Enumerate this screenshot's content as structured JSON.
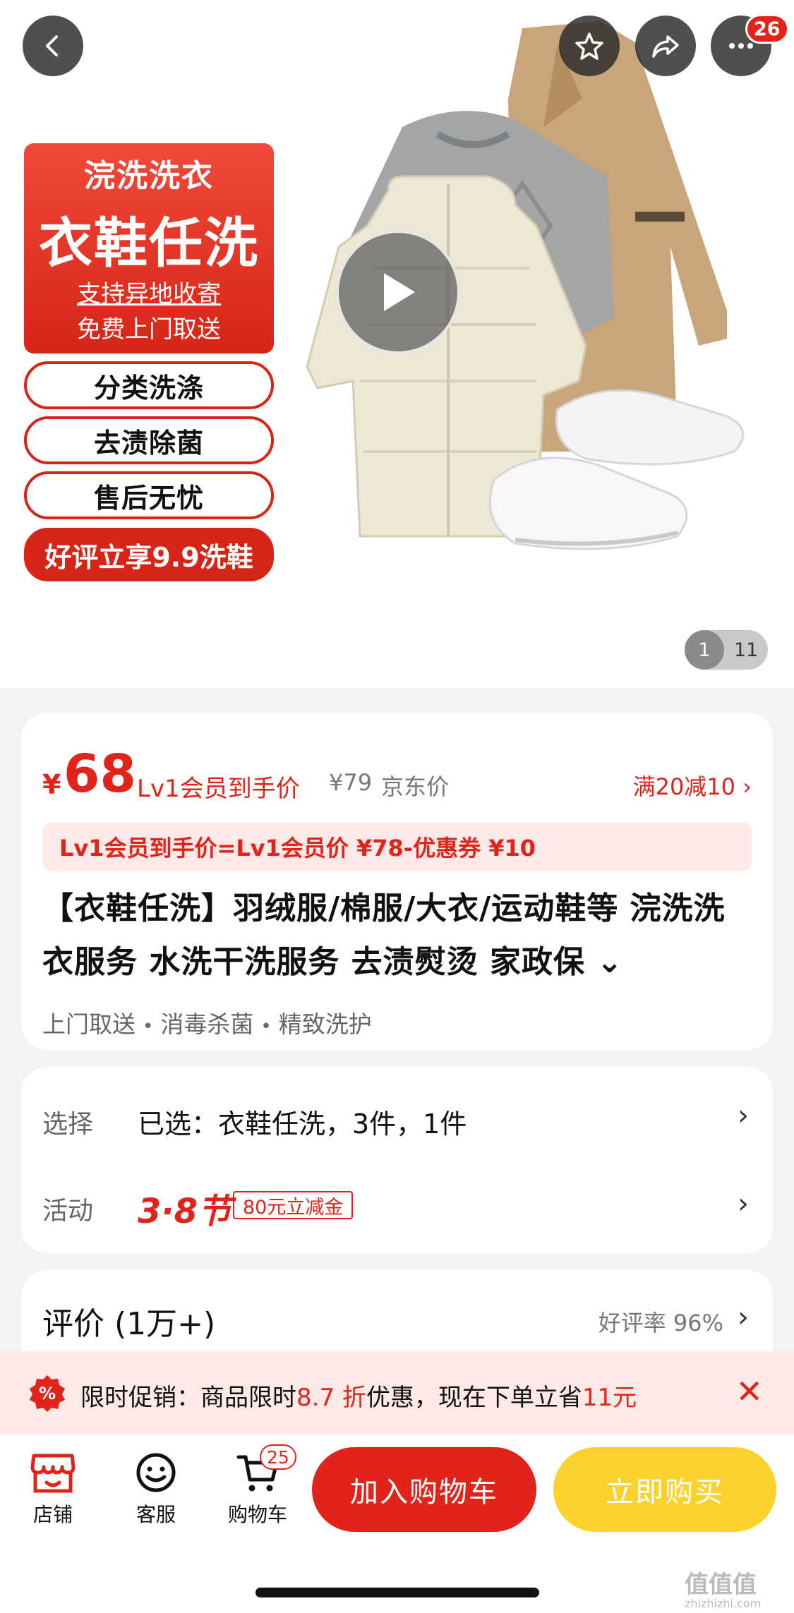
{
  "top_bar": {
    "back_icon": "chevron-left-icon",
    "favorite_icon": "star-icon",
    "share_icon": "share-icon",
    "more_icon": "more-dots-icon",
    "message_badge": "26"
  },
  "hero": {
    "promo_top": "浣洗洗衣",
    "promo_main": "衣鞋任洗",
    "promo_line1": "支持异地收寄",
    "promo_line2": "免费上门取送",
    "pills": [
      "分类洗涤",
      "去渍除菌",
      "售后无忧"
    ],
    "promo_bottom": "好评立享9.9洗鞋",
    "play_icon": "play-icon",
    "page_current": "1",
    "page_total": "11"
  },
  "price": {
    "currency": "¥",
    "value": "68",
    "member_label": "Lv1会员到手价",
    "old_price": "¥79",
    "jd_price_label": "京东价",
    "full_reduction": "满20减10 ›",
    "formula": "Lv1会员到手价=Lv1会员价 ¥78-优惠券 ¥10"
  },
  "product": {
    "title": "【衣鞋任洗】羽绒服/棉服/大衣/运动鞋等 浣洗洗衣服务 水洗干洗服务 去渍熨烫 家政保 ⌄",
    "tags": [
      "上门取送",
      "消毒杀菌",
      "精致洗护"
    ]
  },
  "options": {
    "select_label": "选择",
    "select_value": "已选：衣鞋任洗，3件，1件",
    "activity_label": "活动",
    "activity_tag": "3·8节",
    "activity_coupon": "80元立减金"
  },
  "review": {
    "title": "评价 (1万+)",
    "rate": "好评率 96%"
  },
  "toast": {
    "icon": "percent-tag-icon",
    "text_prefix": "限时促销：商品限时",
    "discount": "8.7 折",
    "text_mid": "优惠，现在下单立省",
    "save": "11元",
    "close_icon": "close-icon"
  },
  "bottom_bar": {
    "store_label": "店铺",
    "service_label": "客服",
    "cart_label": "购物车",
    "cart_badge": "25",
    "add_cart": "加入购物车",
    "buy_now": "立即购买"
  },
  "watermark": {
    "text": "值值值",
    "site": "zhizhizhi.com"
  },
  "colors": {
    "accent_red": "#e2231a",
    "buy_yellow": "#fbd22c",
    "toast_bg": "#fde9e6"
  }
}
